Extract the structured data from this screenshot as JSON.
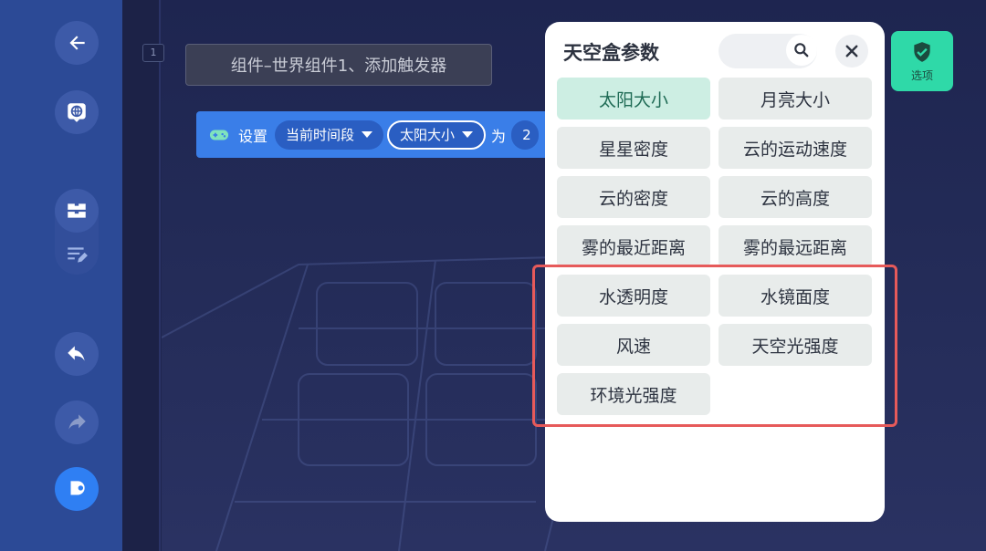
{
  "sidebar": {
    "buttons": [
      {
        "name": "back-icon"
      },
      {
        "name": "globe-icon"
      },
      {
        "name": "blocks-icon"
      },
      {
        "name": "edit-list-icon"
      },
      {
        "name": "undo-icon"
      },
      {
        "name": "redo-icon"
      },
      {
        "name": "run-icon"
      }
    ]
  },
  "workspace": {
    "line_number": "1",
    "comment": "组件–世界组件1、添加触发器",
    "code_block": {
      "set_label": "设置",
      "dropdown1": "当前时间段",
      "dropdown2": "太阳大小",
      "as_label": "为",
      "value_partial": "2"
    }
  },
  "options_button": {
    "label": "选项"
  },
  "panel": {
    "title": "天空盒参数",
    "search_placeholder": "",
    "items": [
      {
        "label": "太阳大小",
        "selected": true
      },
      {
        "label": "月亮大小",
        "selected": false
      },
      {
        "label": "星星密度",
        "selected": false
      },
      {
        "label": "云的运动速度",
        "selected": false
      },
      {
        "label": "云的密度",
        "selected": false
      },
      {
        "label": "云的高度",
        "selected": false
      },
      {
        "label": "雾的最近距离",
        "selected": false
      },
      {
        "label": "雾的最远距离",
        "selected": false
      },
      {
        "label": "水透明度",
        "selected": false
      },
      {
        "label": "水镜面度",
        "selected": false
      },
      {
        "label": "风速",
        "selected": false
      },
      {
        "label": "天空光强度",
        "selected": false
      },
      {
        "label": "环境光强度",
        "selected": false
      }
    ]
  },
  "colors": {
    "sidebar": "#2c4a96",
    "workspace": "#1f2650",
    "block_blue": "#3a7ee8",
    "accent_green": "#2fd9a8",
    "selected_item": "#cdeee3",
    "highlight_red": "#e65a5a"
  }
}
